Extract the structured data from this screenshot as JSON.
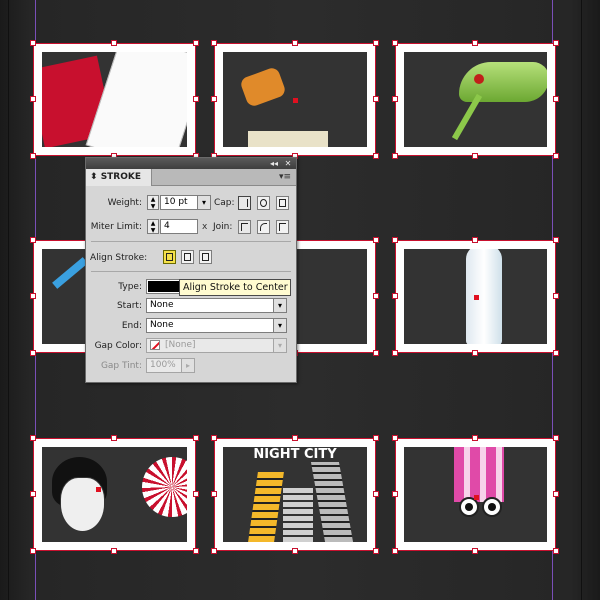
{
  "panel": {
    "tab_label": "STROKE",
    "collapse_glyph": "◂◂",
    "close_glyph": "✕",
    "menu_glyph": "▾≡",
    "weight_label": "Weight:",
    "weight_value": "10 pt",
    "cap_label": "Cap:",
    "miter_label": "Miter Limit:",
    "miter_value": "4",
    "miter_unit": "x",
    "join_label": "Join:",
    "align_label": "Align Stroke:",
    "type_label": "Type:",
    "start_label": "Start:",
    "start_value": "None",
    "end_label": "End:",
    "end_value": "None",
    "gap_color_label": "Gap Color:",
    "gap_color_value": "[None]",
    "gap_tint_label": "Gap Tint:",
    "gap_tint_value": "100%",
    "tooltip": "Align Stroke to Center",
    "align_selected": "center"
  },
  "canvas": {
    "frames": [
      {
        "name": "frame-cards",
        "image": "playing-cards-image"
      },
      {
        "name": "frame-gloves",
        "image": "boxing-gloves-image"
      },
      {
        "name": "frame-grasshopper",
        "image": "grasshopper-image"
      },
      {
        "name": "frame-pencil",
        "image": "pencil-image"
      },
      {
        "name": "frame-flower",
        "image": "flower-image"
      },
      {
        "name": "frame-bottle",
        "image": "bottle-image"
      },
      {
        "name": "frame-man",
        "image": "man-face-image"
      },
      {
        "name": "frame-night-city",
        "image": "night-city-image",
        "caption": "NIGHT CITY"
      },
      {
        "name": "frame-eyes",
        "image": "cartoon-eyes-image"
      }
    ]
  },
  "colors": {
    "frame_stroke": "#c8102e",
    "guide": "#7a4fb8",
    "tooltip_bg": "#fffbd0",
    "selected_button": "#f5e14a"
  }
}
